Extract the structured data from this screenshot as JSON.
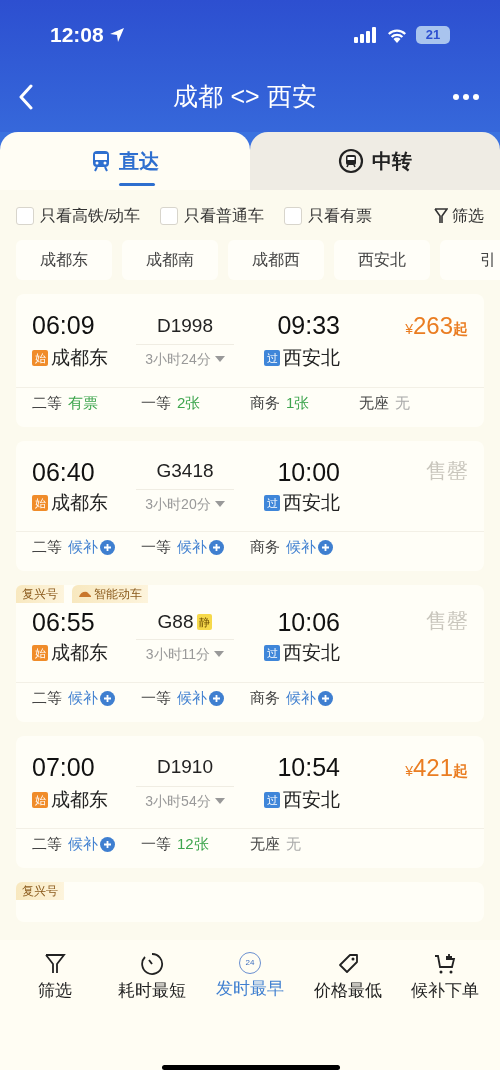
{
  "status_bar": {
    "time": "12:08",
    "battery": "21"
  },
  "header": {
    "title": "成都 <> 西安"
  },
  "tabs": [
    {
      "label": "直达",
      "selected": true
    },
    {
      "label": "中转",
      "selected": false
    }
  ],
  "filters": [
    {
      "label": "只看高铁/动车",
      "checked": false
    },
    {
      "label": "只看普通车",
      "checked": false
    },
    {
      "label": "只看有票",
      "checked": false
    }
  ],
  "filter_button": "筛选",
  "station_chips": [
    "成都东",
    "成都南",
    "成都西",
    "西安北",
    "引"
  ],
  "trains": [
    {
      "kind": "full",
      "depart": "06:09",
      "train_no": "D1998",
      "arrive": "09:33",
      "fare": {
        "kind": "price",
        "currency": "¥",
        "amount": "263",
        "suffix": "起"
      },
      "from_badge": "始",
      "from": "成都东",
      "duration": "3小时24分",
      "to_badge": "过",
      "to": "西安北",
      "seats": [
        {
          "class": "二等",
          "status": "有票",
          "kind": "available"
        },
        {
          "class": "一等",
          "status": "2张",
          "kind": "available"
        },
        {
          "class": "商务",
          "status": "1张",
          "kind": "available"
        },
        {
          "class": "无座",
          "status": "无",
          "kind": "none"
        }
      ]
    },
    {
      "kind": "full",
      "depart": "06:40",
      "train_no": "G3418",
      "arrive": "10:00",
      "fare": {
        "kind": "sold_out",
        "text": "售罄"
      },
      "from_badge": "始",
      "from": "成都东",
      "duration": "3小时20分",
      "to_badge": "过",
      "to": "西安北",
      "seats": [
        {
          "class": "二等",
          "status": "候补",
          "kind": "waitlist"
        },
        {
          "class": "一等",
          "status": "候补",
          "kind": "waitlist"
        },
        {
          "class": "商务",
          "status": "候补",
          "kind": "waitlist"
        }
      ]
    },
    {
      "kind": "full",
      "tags": [
        {
          "text": "复兴号",
          "kind": "plain"
        },
        {
          "text": "智能动车",
          "kind": "smart"
        }
      ],
      "depart": "06:55",
      "train_no": "G88",
      "quiet_badge": "静",
      "arrive": "10:06",
      "fare": {
        "kind": "sold_out",
        "text": "售罄"
      },
      "from_badge": "始",
      "from": "成都东",
      "duration": "3小时11分",
      "to_badge": "过",
      "to": "西安北",
      "seats": [
        {
          "class": "二等",
          "status": "候补",
          "kind": "waitlist"
        },
        {
          "class": "一等",
          "status": "候补",
          "kind": "waitlist"
        },
        {
          "class": "商务",
          "status": "候补",
          "kind": "waitlist"
        }
      ]
    },
    {
      "kind": "full",
      "depart": "07:00",
      "train_no": "D1910",
      "arrive": "10:54",
      "fare": {
        "kind": "price",
        "currency": "¥",
        "amount": "421",
        "suffix": "起"
      },
      "from_badge": "始",
      "from": "成都东",
      "duration": "3小时54分",
      "to_badge": "过",
      "to": "西安北",
      "seats": [
        {
          "class": "二等",
          "status": "候补",
          "kind": "waitlist"
        },
        {
          "class": "一等",
          "status": "12张",
          "kind": "available"
        },
        {
          "class": "无座",
          "status": "无",
          "kind": "none"
        }
      ]
    },
    {
      "kind": "partial",
      "tags": [
        {
          "text": "复兴号",
          "kind": "plain"
        }
      ]
    }
  ],
  "bottom_nav": [
    {
      "label": "筛选",
      "selected": false
    },
    {
      "label": "耗时最短",
      "selected": false
    },
    {
      "label": "发时最早",
      "icon_text": "24",
      "selected": true
    },
    {
      "label": "价格最低",
      "selected": false
    },
    {
      "label": "候补下单",
      "selected": false
    }
  ]
}
